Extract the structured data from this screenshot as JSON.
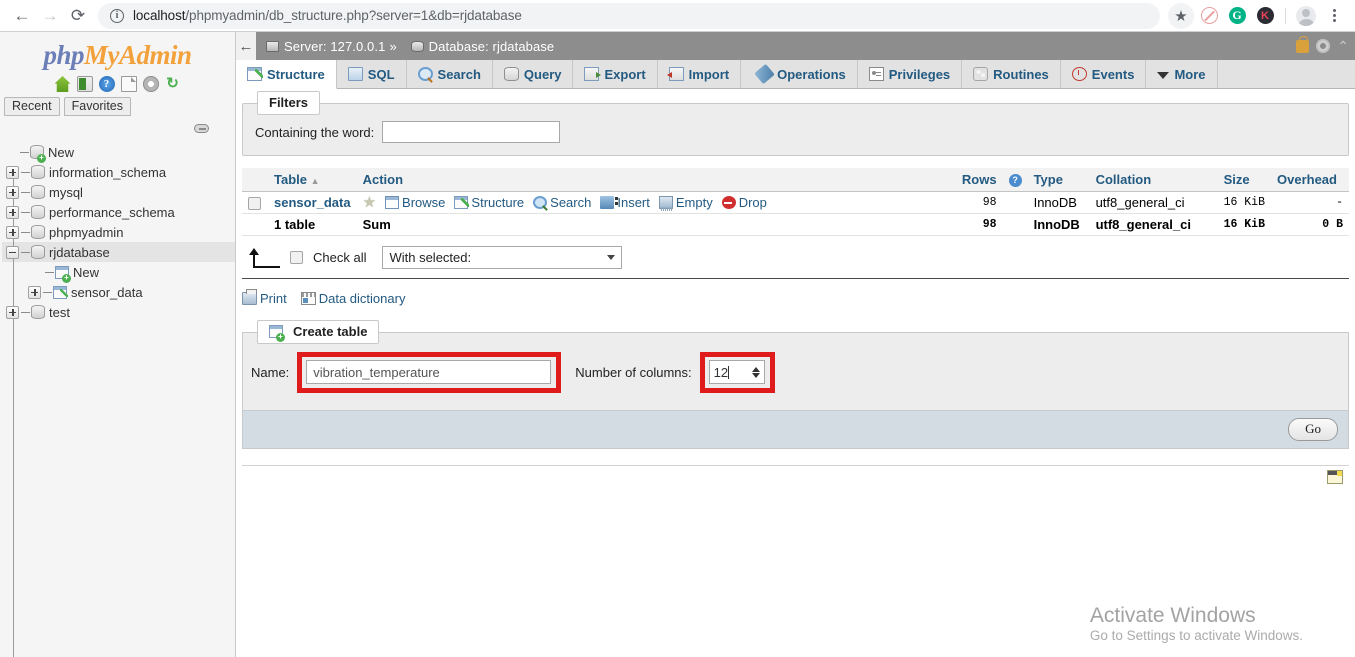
{
  "browser": {
    "back_icon": "back-arrow-icon",
    "forward_icon": "forward-arrow-icon",
    "reload_icon": "reload-icon",
    "info_glyph": "i",
    "url_host": "localhost",
    "url_path": "/phpmyadmin/db_structure.php?server=1&db=rjdatabase",
    "star_icon": "★",
    "ext_g_label": "G",
    "ext_k_label": "K",
    "menu_icon": "three-dots-icon"
  },
  "sidebar": {
    "logo": {
      "php": "php",
      "my": "My",
      "admin": "Admin"
    },
    "logo_icons": [
      "home-icon",
      "logout-icon",
      "help-icon",
      "documentation-icon",
      "settings-icon",
      "reload-icon"
    ],
    "mini_tabs": [
      {
        "label": "Recent"
      },
      {
        "label": "Favorites"
      }
    ],
    "tree": [
      {
        "label": "New",
        "type": "new-db",
        "expander": "none",
        "indent": 1
      },
      {
        "label": "information_schema",
        "type": "db",
        "expander": "plus",
        "indent": 0
      },
      {
        "label": "mysql",
        "type": "db",
        "expander": "plus",
        "indent": 0
      },
      {
        "label": "performance_schema",
        "type": "db",
        "expander": "plus",
        "indent": 0
      },
      {
        "label": "phpmyadmin",
        "type": "db",
        "expander": "plus",
        "indent": 0
      },
      {
        "label": "rjdatabase",
        "type": "db",
        "expander": "minus",
        "indent": 0,
        "active": true
      },
      {
        "label": "New",
        "type": "new-table",
        "expander": "none",
        "indent": 2
      },
      {
        "label": "sensor_data",
        "type": "table",
        "expander": "plus",
        "indent": 1
      },
      {
        "label": "test",
        "type": "db",
        "expander": "plus",
        "indent": 0
      }
    ]
  },
  "serverbar": {
    "server_label": "Server: 127.0.0.1",
    "separator": "»",
    "database_label": "Database: rjdatabase",
    "right_icons": [
      "lock-icon",
      "gear-icon",
      "collapse-icon"
    ]
  },
  "tabs": [
    {
      "label": "Structure",
      "icon": "structure-icon",
      "active": true
    },
    {
      "label": "SQL",
      "icon": "sql-icon",
      "active": false
    },
    {
      "label": "Search",
      "icon": "search-icon",
      "active": false
    },
    {
      "label": "Query",
      "icon": "query-icon",
      "active": false
    },
    {
      "label": "Export",
      "icon": "export-icon",
      "active": false
    },
    {
      "label": "Import",
      "icon": "import-icon",
      "active": false
    },
    {
      "label": "Operations",
      "icon": "operations-icon",
      "active": false
    },
    {
      "label": "Privileges",
      "icon": "privileges-icon",
      "active": false
    },
    {
      "label": "Routines",
      "icon": "routines-icon",
      "active": false
    },
    {
      "label": "Events",
      "icon": "events-icon",
      "active": false
    },
    {
      "label": "More",
      "icon": "chevron-down-icon",
      "active": false
    }
  ],
  "filters": {
    "legend": "Filters",
    "label": "Containing the word:",
    "value": "",
    "placeholder": ""
  },
  "tables_table": {
    "headers": {
      "checkbox": "",
      "table": "Table",
      "sort_glyph": "▲",
      "action": "Action",
      "rows": "Rows",
      "rows_help": "?",
      "type": "Type",
      "collation": "Collation",
      "size": "Size",
      "overhead": "Overhead"
    },
    "rows": [
      {
        "name": "sensor_data",
        "favorite_icon": "star-icon",
        "actions": [
          {
            "label": "Browse",
            "icon": "browse-icon"
          },
          {
            "label": "Structure",
            "icon": "structure-icon"
          },
          {
            "label": "Search",
            "icon": "search-icon"
          },
          {
            "label": "Insert",
            "icon": "insert-icon"
          },
          {
            "label": "Empty",
            "icon": "empty-icon"
          },
          {
            "label": "Drop",
            "icon": "drop-icon"
          }
        ],
        "rows_count": "98",
        "type": "InnoDB",
        "collation": "utf8_general_ci",
        "size": "16 KiB",
        "overhead": "-"
      }
    ],
    "summary": {
      "count_label": "1 table",
      "sum_label": "Sum",
      "rows_count": "98",
      "type": "InnoDB",
      "collation": "utf8_general_ci",
      "size": "16 KiB",
      "overhead": "0 B"
    }
  },
  "bulk_actions": {
    "check_all_label": "Check all",
    "with_selected_label": "With selected:",
    "caret_icon": "chevron-down-icon"
  },
  "links_row": [
    {
      "label": "Print",
      "icon": "printer-icon"
    },
    {
      "label": "Data dictionary",
      "icon": "data-dictionary-icon"
    }
  ],
  "create_table": {
    "legend": "Create table",
    "legend_icon": "new-table-icon",
    "name_label": "Name:",
    "name_value": "vibration_temperature",
    "columns_label": "Number of columns:",
    "columns_value": "12",
    "go_label": "Go",
    "highlight_color": "#e01b1b"
  },
  "console": {
    "icon": "console-toggle-icon"
  },
  "watermark": {
    "title": "Activate Windows",
    "subtitle": "Go to Settings to activate Windows."
  }
}
